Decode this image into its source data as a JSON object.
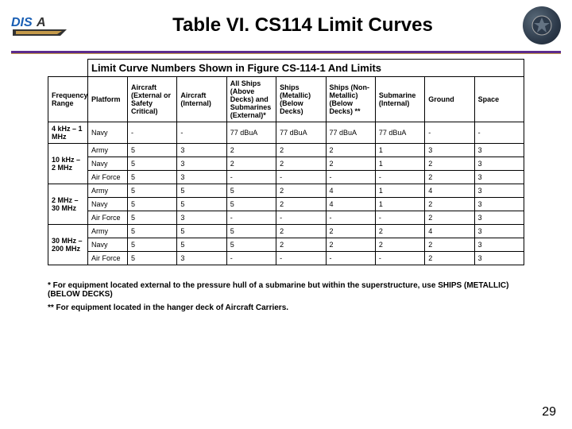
{
  "page_title": "Table VI.  CS114 Limit Curves",
  "logo_left_text": "DISA",
  "table_banner": "Limit Curve Numbers Shown in Figure CS-114-1 And Limits",
  "row_header_label": "Frequency Range",
  "platform_label": "Platform",
  "columns": [
    "Aircraft (External or Safety Critical)",
    "Aircraft (Internal)",
    "All Ships (Above Decks) and Submarines (External)*",
    "Ships (Metallic) (Below Decks)",
    "Ships (Non-Metallic) (Below Decks) **",
    "Submarine (Internal)",
    "Ground",
    "Space"
  ],
  "rows": [
    {
      "freq": "4 kHz – 1 MHz",
      "platforms": [
        {
          "name": "Navy",
          "values": [
            "-",
            "-",
            "77 dBuA",
            "77 dBuA",
            "77 dBuA",
            "77 dBuA",
            "-",
            "-"
          ]
        }
      ]
    },
    {
      "freq": "10 kHz – 2 MHz",
      "platforms": [
        {
          "name": "Army",
          "values": [
            "5",
            "3",
            "2",
            "2",
            "2",
            "1",
            "3",
            "3"
          ]
        },
        {
          "name": "Navy",
          "values": [
            "5",
            "3",
            "2",
            "2",
            "2",
            "1",
            "2",
            "3"
          ]
        },
        {
          "name": "Air Force",
          "values": [
            "5",
            "3",
            "-",
            "-",
            "-",
            "-",
            "2",
            "3"
          ]
        }
      ]
    },
    {
      "freq": "2 MHz – 30 MHz",
      "platforms": [
        {
          "name": "Army",
          "values": [
            "5",
            "5",
            "5",
            "2",
            "4",
            "1",
            "4",
            "3"
          ]
        },
        {
          "name": "Navy",
          "values": [
            "5",
            "5",
            "5",
            "2",
            "4",
            "1",
            "2",
            "3"
          ]
        },
        {
          "name": "Air Force",
          "values": [
            "5",
            "3",
            "-",
            "-",
            "-",
            "-",
            "2",
            "3"
          ]
        }
      ]
    },
    {
      "freq": "30 MHz – 200 MHz",
      "platforms": [
        {
          "name": "Army",
          "values": [
            "5",
            "5",
            "5",
            "2",
            "2",
            "2",
            "4",
            "3"
          ]
        },
        {
          "name": "Navy",
          "values": [
            "5",
            "5",
            "5",
            "2",
            "2",
            "2",
            "2",
            "3"
          ]
        },
        {
          "name": "Air Force",
          "values": [
            "5",
            "3",
            "-",
            "-",
            "-",
            "-",
            "2",
            "3"
          ]
        }
      ]
    }
  ],
  "footnote1": "* For equipment located external to the pressure hull of a submarine but within the superstructure, use SHIPS (METALLIC) (BELOW DECKS)",
  "footnote2": "** For equipment located in the hanger deck of Aircraft Carriers.",
  "page_number": "29",
  "chart_data": {
    "type": "table",
    "title": "Table VI. CS114 Limit Curves — Limit Curve Numbers Shown in Figure CS-114-1 And Limits",
    "columns": [
      "Frequency Range",
      "Platform",
      "Aircraft (External or Safety Critical)",
      "Aircraft (Internal)",
      "All Ships (Above Decks) and Submarines (External)*",
      "Ships (Metallic) (Below Decks)",
      "Ships (Non-Metallic) (Below Decks) **",
      "Submarine (Internal)",
      "Ground",
      "Space"
    ],
    "rows": [
      [
        "4 kHz – 1 MHz",
        "Navy",
        "-",
        "-",
        "77 dBuA",
        "77 dBuA",
        "77 dBuA",
        "77 dBuA",
        "-",
        "-"
      ],
      [
        "10 kHz – 2 MHz",
        "Army",
        "5",
        "3",
        "2",
        "2",
        "2",
        "1",
        "3",
        "3"
      ],
      [
        "10 kHz – 2 MHz",
        "Navy",
        "5",
        "3",
        "2",
        "2",
        "2",
        "1",
        "2",
        "3"
      ],
      [
        "10 kHz – 2 MHz",
        "Air Force",
        "5",
        "3",
        "-",
        "-",
        "-",
        "-",
        "2",
        "3"
      ],
      [
        "2 MHz – 30 MHz",
        "Army",
        "5",
        "5",
        "5",
        "2",
        "4",
        "1",
        "4",
        "3"
      ],
      [
        "2 MHz – 30 MHz",
        "Navy",
        "5",
        "5",
        "5",
        "2",
        "4",
        "1",
        "2",
        "3"
      ],
      [
        "2 MHz – 30 MHz",
        "Air Force",
        "5",
        "3",
        "-",
        "-",
        "-",
        "-",
        "2",
        "3"
      ],
      [
        "30 MHz – 200 MHz",
        "Army",
        "5",
        "5",
        "5",
        "2",
        "2",
        "2",
        "4",
        "3"
      ],
      [
        "30 MHz – 200 MHz",
        "Navy",
        "5",
        "5",
        "5",
        "2",
        "2",
        "2",
        "2",
        "3"
      ],
      [
        "30 MHz – 200 MHz",
        "Air Force",
        "5",
        "3",
        "-",
        "-",
        "-",
        "-",
        "2",
        "3"
      ]
    ]
  }
}
